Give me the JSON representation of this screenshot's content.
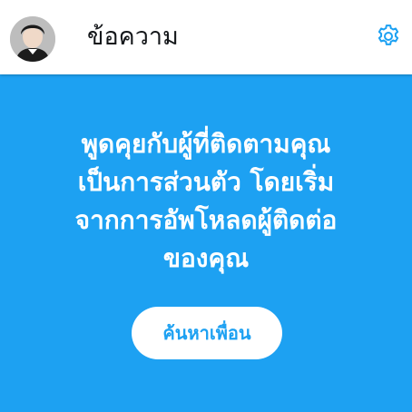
{
  "header": {
    "title": "ข้อความ",
    "avatar_icon": "user-avatar",
    "settings_icon": "gear-icon"
  },
  "main": {
    "message": "พูดคุยกับผู้ที่ติดตามคุณ\nเป็นการส่วนตัว โดยเริ่ม\nจากการอัพโหลดผู้ติดต่อ\nของคุณ",
    "find_friends_label": "ค้นหาเพื่อน"
  },
  "colors": {
    "accent": "#1da1f2",
    "header_bg": "#ffffff",
    "title_text": "#14171a",
    "message_text": "#ffffff"
  }
}
